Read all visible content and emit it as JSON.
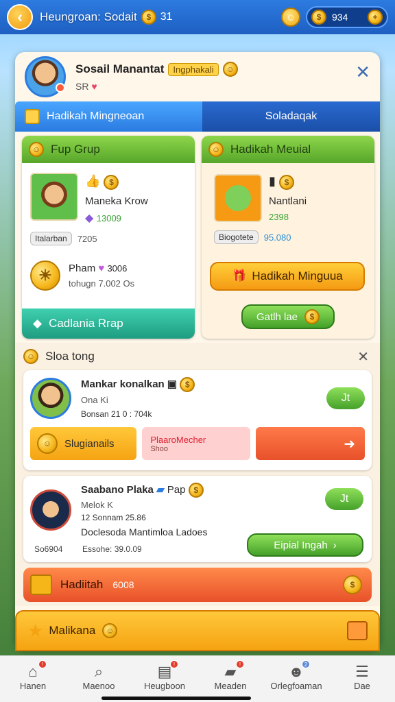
{
  "topbar": {
    "title": "Heungroan: Sodait",
    "coins_label": "31",
    "currency_value": "934"
  },
  "profile": {
    "name": "Sosail Manantat",
    "tag": "Ingphakali",
    "sub": "SR"
  },
  "tabs": [
    {
      "label": "Hadikah Mingneoan"
    },
    {
      "label": "Soladaqak"
    }
  ],
  "left_card": {
    "title": "Fup Grup",
    "game1": {
      "name": "Maneka Krow",
      "stat": "13009",
      "tag": "Italarban",
      "tag_value": "7205"
    },
    "game2": {
      "name": "Pham",
      "stat": "3006",
      "sub": "tohugn 7.002 Os"
    },
    "footer_button": "Cadlania Rrap"
  },
  "right_card": {
    "title": "Hadikah Meuial",
    "game": {
      "name": "Nantlani",
      "stat": "2398",
      "tag": "Biogotete",
      "tag_value": "95.080"
    },
    "primary_button": "Hadikah Minguua",
    "secondary_button": "Gatlh lae"
  },
  "section": {
    "title": "Sloa tong",
    "friend1": {
      "name": "Mankar konalkan",
      "sub": "Ona Ki",
      "stats": "Bonsan 21  0 : 704k",
      "actions": [
        {
          "label": "Slugianails"
        },
        {
          "label": "PlaaroMecher",
          "sub": "Shoo"
        },
        {
          "label": ""
        }
      ],
      "like_label": "Jt"
    },
    "friend2": {
      "name": "Saabano Plaka",
      "tag": "Pap",
      "sub": "Melok K",
      "stats": "12 Sonnam  25.86",
      "desc": "Doclesoda Mantimloa Ladoes",
      "footer_left": "So6904",
      "footer_mid": "Essohe: 39.0.09",
      "button": "Eipial Ingah",
      "like_label": "Jt"
    },
    "hadiah_bar": {
      "label": "Hadiitah",
      "value": "6008"
    }
  },
  "mall": {
    "label": "Malikana"
  },
  "nav": [
    {
      "label": "Hanen",
      "icon": "home-icon"
    },
    {
      "label": "Maenoo",
      "icon": "search-icon"
    },
    {
      "label": "Heugboon",
      "icon": "inbox-icon"
    },
    {
      "label": "Meaden",
      "icon": "chat-icon"
    },
    {
      "label": "Orlegfoaman",
      "icon": "friends-icon"
    },
    {
      "label": "Dae",
      "icon": "menu-icon"
    }
  ]
}
